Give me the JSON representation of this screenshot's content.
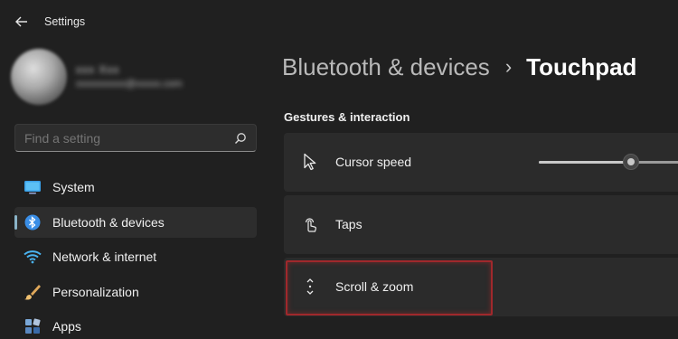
{
  "app": {
    "title": "Settings"
  },
  "profile": {
    "name": "xxx Xxx",
    "email": "xxxxxxxxxx@xxxxx.com"
  },
  "search": {
    "placeholder": "Find a setting"
  },
  "sidebar": {
    "items": [
      {
        "label": "System",
        "icon": "monitor-icon",
        "active": false
      },
      {
        "label": "Bluetooth & devices",
        "icon": "bluetooth-icon",
        "active": true
      },
      {
        "label": "Network & internet",
        "icon": "wifi-icon",
        "active": false
      },
      {
        "label": "Personalization",
        "icon": "brush-icon",
        "active": false
      },
      {
        "label": "Apps",
        "icon": "apps-icon",
        "active": false
      }
    ]
  },
  "header": {
    "parent": "Bluetooth & devices",
    "separator": "›",
    "current": "Touchpad"
  },
  "section": {
    "title": "Gestures & interaction"
  },
  "cards": [
    {
      "label": "Cursor speed",
      "icon": "cursor-icon",
      "slider_value": 0.6
    },
    {
      "label": "Taps",
      "icon": "tap-icon"
    },
    {
      "label": "Scroll & zoom",
      "icon": "scroll-icon",
      "highlighted": true
    }
  ],
  "colors": {
    "background": "#202020",
    "card": "#2b2b2b",
    "accent": "#8ab4c8",
    "highlight": "#a0282c",
    "bluetooth": "#3a8ee6"
  }
}
